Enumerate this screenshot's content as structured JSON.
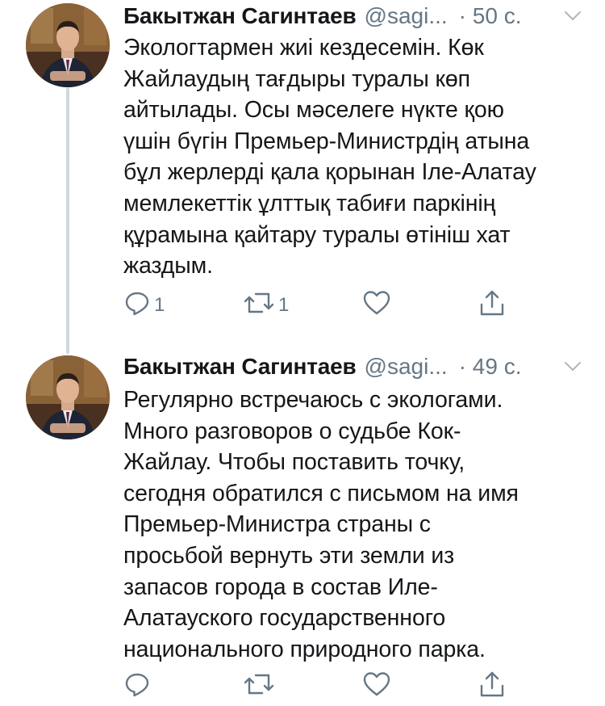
{
  "colors": {
    "text": "#14171a",
    "secondary": "#657786",
    "thread_line": "#cfd9de",
    "background": "#ffffff"
  },
  "tweets": [
    {
      "author_name": "Бакытжан Сагинтаев",
      "handle": "@sagi...",
      "time": "· 50 с.",
      "text": "Экологтармен жиі кездесемін. Көк\nЖайлаудың тағдыры туралы көп\nайтылады. Осы мәселеге нүкте қою\nүшін бүгін Премьер-Министрдің атына\nбұл жерлерді қала қорынан Іле-Алатау\nмемлекеттік ұлттық табиғи паркінің\nқұрамына қайтару туралы өтініш хат\nжаздым.",
      "reply_count": "1",
      "retweet_count": "1",
      "like_count": "",
      "icons": [
        "reply-icon",
        "retweet-icon",
        "like-icon",
        "share-icon",
        "chevron-down-icon"
      ]
    },
    {
      "author_name": "Бакытжан Сагинтаев",
      "handle": "@sagi...",
      "time": "· 49 с.",
      "text": "Регулярно встречаюсь с экологами.\nМного разговоров о судьбе Кок-\nЖайлау. Чтобы поставить точку,\nсегодня обратился с письмом на имя\nПремьер-Министра страны с\nпросьбой вернуть эти земли из\nзапасов города в состав Иле-\nАлатауского государственного\nнационального природного парка.",
      "reply_count": "",
      "retweet_count": "",
      "like_count": "",
      "icons": [
        "reply-icon",
        "retweet-icon",
        "like-icon",
        "share-icon",
        "chevron-down-icon"
      ]
    }
  ]
}
